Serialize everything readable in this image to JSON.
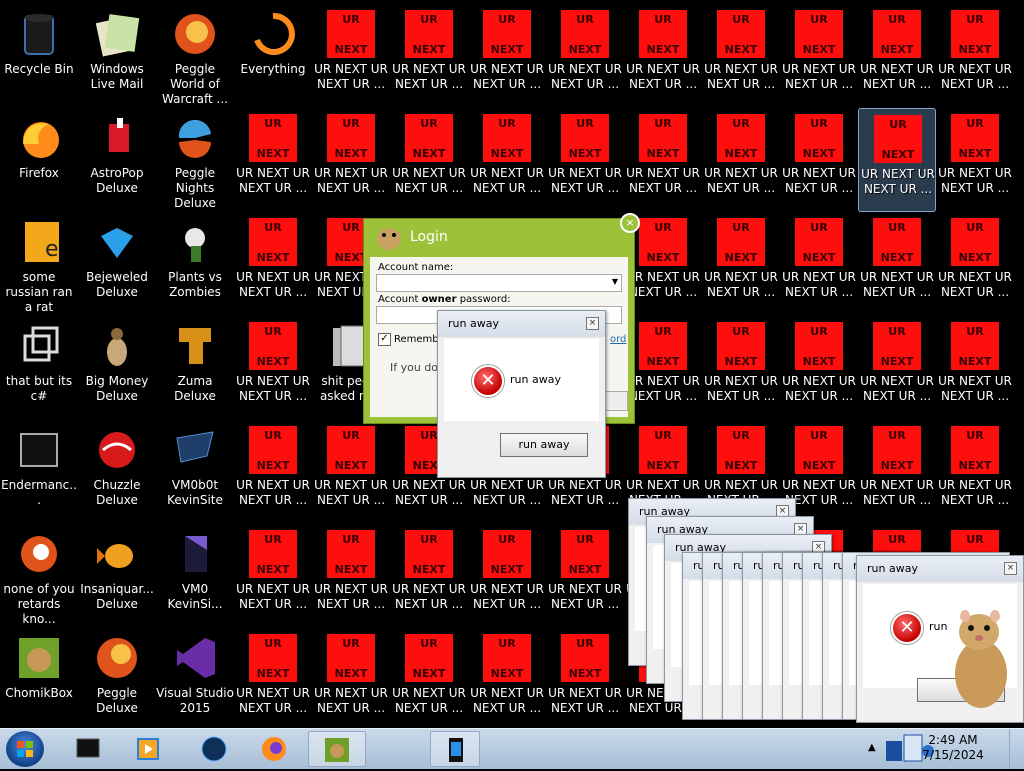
{
  "desktop": {
    "icons": [
      {
        "label": "Recycle Bin",
        "icon": "recycle-bin-icon"
      },
      {
        "label": "Windows Live Mail",
        "icon": "mail-icon"
      },
      {
        "label": "Peggle World of Warcraft ...",
        "icon": "peggle-icon"
      },
      {
        "label": "Everything",
        "icon": "search-icon"
      },
      {
        "label": "Firefox",
        "icon": "firefox-icon"
      },
      {
        "label": "AstroPop Deluxe",
        "icon": "astropop-icon"
      },
      {
        "label": "Peggle Nights Deluxe",
        "icon": "peggle-nights-icon"
      },
      {
        "label": "some russian ran a rat",
        "icon": "app-icon"
      },
      {
        "label": "Bejeweled Deluxe",
        "icon": "gem-icon"
      },
      {
        "label": "Plants vs Zombies",
        "icon": "plant-icon"
      },
      {
        "label": "that but its c#",
        "icon": "shortcut-icon"
      },
      {
        "label": "Big Money Deluxe",
        "icon": "money-icon"
      },
      {
        "label": "Zuma Deluxe",
        "icon": "zuma-icon"
      },
      {
        "label": "shit peo... asked m...",
        "icon": "folder-icon"
      },
      {
        "label": "Endermanc...",
        "icon": "app-window-icon"
      },
      {
        "label": "Chuzzle Deluxe",
        "icon": "chuzzle-icon"
      },
      {
        "label": "VM0b0t KevinSite",
        "icon": "vm-icon"
      },
      {
        "label": "none of you retards kno...",
        "icon": "app-icon"
      },
      {
        "label": "Insaniquar... Deluxe",
        "icon": "fish-icon"
      },
      {
        "label": "VM0 KevinSi...",
        "icon": "vm-icon"
      },
      {
        "label": "ChomikBox",
        "icon": "chomikbox-icon"
      },
      {
        "label": "Peggle Deluxe",
        "icon": "peggle-icon"
      },
      {
        "label": "Visual Studio 2015",
        "icon": "visual-studio-icon"
      }
    ],
    "ur_label": "UR NEXT UR NEXT UR ...",
    "ur_top": "UR",
    "ur_bottom": "NEXT"
  },
  "login": {
    "title": "Login",
    "account_name_label": "Account name:",
    "password_label_pre": "Account ",
    "password_label_bold": "owner",
    "password_label_post": " password:",
    "remember_label": "Remember",
    "remember_checked": true,
    "forgot_link": "ord",
    "info_text": "If you do"
  },
  "dialog": {
    "title": "run away",
    "message": "run away",
    "button": "run away",
    "close": "×"
  },
  "dialog_front": {
    "title": "run away",
    "message": "run"
  },
  "taskbar": {
    "time": "2:49 AM",
    "date": "7/15/2024",
    "tray_arrow": "▲"
  },
  "colors": {
    "ur_red": "#ff0e0e",
    "login_green": "#9cc23a",
    "error_red": "#c40000",
    "taskbar": "#b7cbe0"
  }
}
